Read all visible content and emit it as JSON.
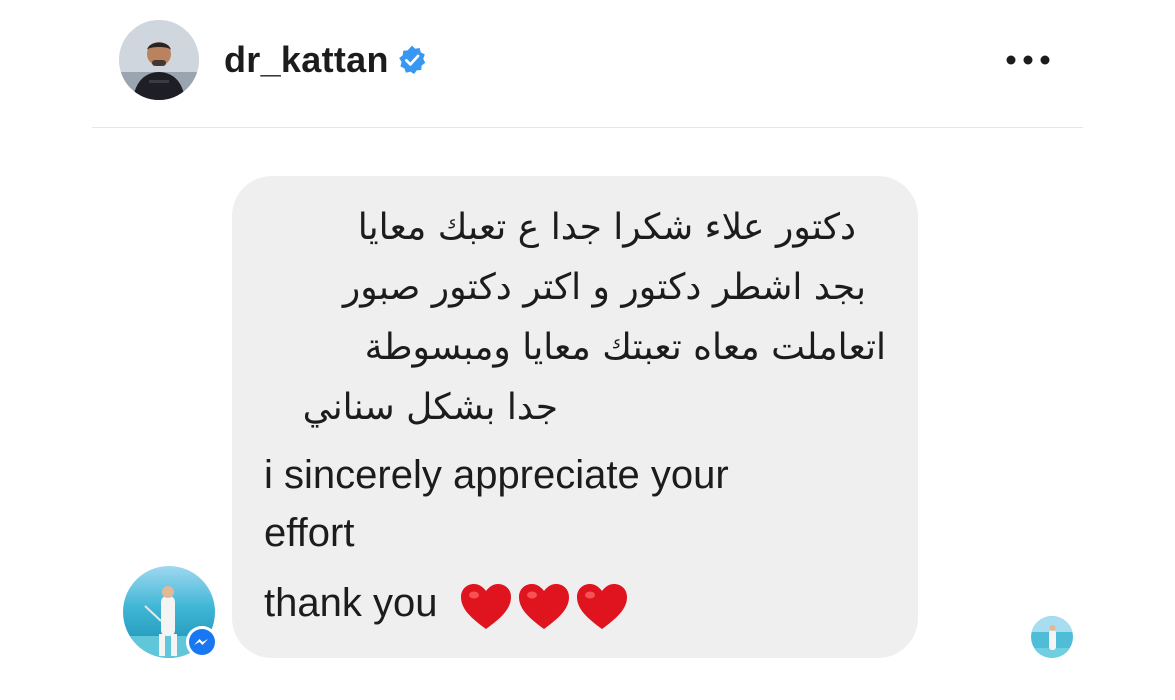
{
  "header": {
    "username": "dr_kattan",
    "verified": true,
    "more_icon": "more-horizontal-icon"
  },
  "message": {
    "arabic_lines": [
      "دكتور علاء شكرا جدا ع تعبك معايا",
      "بجد اشطر دكتور و اكتر دكتور صبور",
      "اتعاملت معاه تعبتك معايا ومبسوطة",
      "جدا بشكل سناني"
    ],
    "english_lines": [
      " i sincerely appreciate your",
      "effort"
    ],
    "closing": "thank you",
    "emoji": [
      "❤️",
      "❤️",
      "❤️"
    ]
  },
  "colors": {
    "bubble": "#efefef",
    "verified_blue": "#3897f0",
    "messenger_blue": "#1877f2",
    "text": "#1c1c1c",
    "heart_red": "#e0141e"
  },
  "icons": {
    "verified": "verified-badge-icon",
    "messenger": "messenger-icon",
    "heart": "heart-icon"
  }
}
